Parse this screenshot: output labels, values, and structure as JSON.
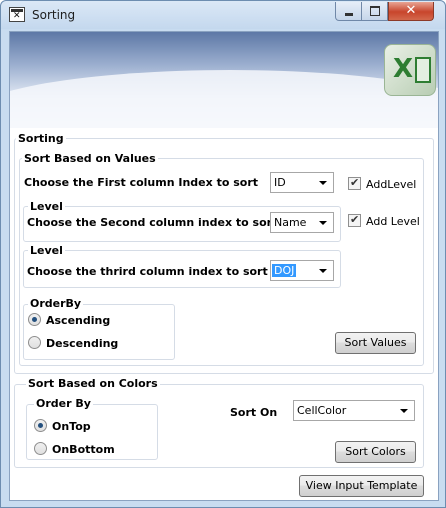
{
  "window": {
    "title": "Sorting"
  },
  "sorting_group": {
    "label": "Sorting"
  },
  "values_group": {
    "label": "Sort Based on Values",
    "first": {
      "label": "Choose the First column Index to sort",
      "value": "ID",
      "checkbox_label": "AddLevel",
      "checked": true
    },
    "level2": {
      "label": "Level",
      "text": "Choose the Second column index to sort.",
      "value": "Name",
      "checkbox_label": "Add Level",
      "checked": true
    },
    "level3": {
      "label": "Level",
      "text": "Choose the thrird column index to sort",
      "value": "DOJ"
    },
    "orderby": {
      "label": "OrderBy",
      "options": [
        "Ascending",
        "Descending"
      ],
      "selected": "Ascending"
    },
    "sort_button": "Sort Values"
  },
  "colors_group": {
    "label": "Sort Based on Colors",
    "orderby": {
      "label": "Order By",
      "options": [
        "OnTop",
        "OnBottom"
      ],
      "selected": "OnTop"
    },
    "sort_on": {
      "label": "Sort On",
      "value": "CellColor"
    },
    "sort_button": "Sort Colors"
  },
  "footer": {
    "view_template_button": "View Input Template"
  },
  "icons": [
    "app-icon",
    "minimize-icon",
    "maximize-icon",
    "close-icon",
    "excel-logo-icon",
    "dropdown-arrow-icon",
    "checkmark-icon"
  ]
}
